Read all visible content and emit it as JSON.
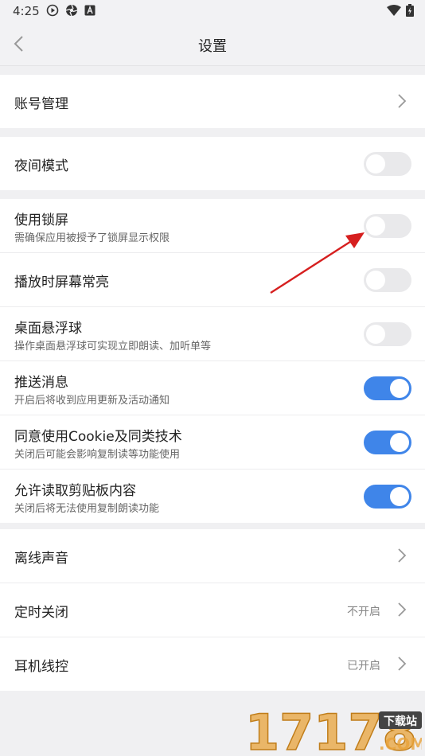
{
  "status_bar": {
    "time": "4:25"
  },
  "header": {
    "title": "设置"
  },
  "groups": {
    "account": {
      "label": "账号管理"
    },
    "night": {
      "label": "夜间模式",
      "toggle": false
    },
    "perm": {
      "lock": {
        "label": "使用锁屏",
        "sub": "需确保应用被授予了锁屏显示权限",
        "toggle": false
      },
      "screen_on": {
        "label": "播放时屏幕常亮",
        "toggle": false
      },
      "float": {
        "label": "桌面悬浮球",
        "sub": "操作桌面悬浮球可实现立即朗读、加听单等",
        "toggle": false
      },
      "push": {
        "label": "推送消息",
        "sub": "开启后将收到应用更新及活动通知",
        "toggle": true
      },
      "cookie": {
        "label": "同意使用Cookie及同类技术",
        "sub": "关闭后可能会影响复制读等功能使用",
        "toggle": true
      },
      "clipboard": {
        "label": "允许读取剪贴板内容",
        "sub": "关闭后将无法使用复制朗读功能",
        "toggle": true
      }
    },
    "misc": {
      "offline": {
        "label": "离线声音"
      },
      "timer": {
        "label": "定时关闭",
        "value": "不开启"
      },
      "headset": {
        "label": "耳机线控",
        "value": "已开启"
      }
    }
  },
  "watermark": {
    "text": "17178",
    "badge": "下载站",
    "domain": ".COM"
  },
  "colors": {
    "accent": "#3f85e9",
    "arrow": "#d61f1f",
    "watermark": "#e8a33a"
  },
  "icons": [
    "play-icon",
    "aperture-icon",
    "a-box-icon",
    "wifi-icon",
    "battery-icon",
    "back-icon",
    "chevron-right-icon"
  ]
}
